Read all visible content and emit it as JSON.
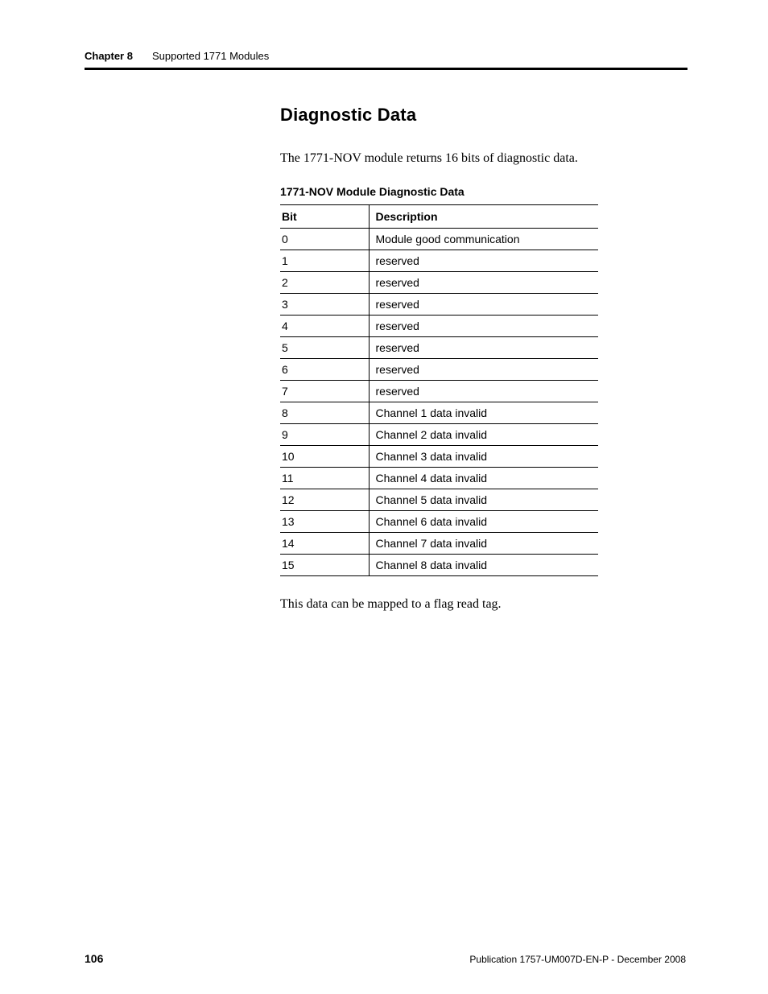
{
  "header": {
    "chapter_label": "Chapter 8",
    "chapter_title": "Supported 1771 Modules"
  },
  "section": {
    "heading": "Diagnostic Data",
    "intro": "The 1771-NOV module returns 16 bits of diagnostic data.",
    "table_title": "1771-NOV Module Diagnostic Data",
    "outro": "This data can be mapped to a flag read tag."
  },
  "table": {
    "col_bit": "Bit",
    "col_desc": "Description",
    "rows": [
      {
        "bit": "0",
        "desc": "Module good communication"
      },
      {
        "bit": "1",
        "desc": "reserved"
      },
      {
        "bit": "2",
        "desc": "reserved"
      },
      {
        "bit": "3",
        "desc": "reserved"
      },
      {
        "bit": "4",
        "desc": "reserved"
      },
      {
        "bit": "5",
        "desc": "reserved"
      },
      {
        "bit": "6",
        "desc": "reserved"
      },
      {
        "bit": "7",
        "desc": "reserved"
      },
      {
        "bit": "8",
        "desc": "Channel 1 data invalid"
      },
      {
        "bit": "9",
        "desc": "Channel 2 data invalid"
      },
      {
        "bit": "10",
        "desc": "Channel 3 data invalid"
      },
      {
        "bit": "11",
        "desc": "Channel 4 data invalid"
      },
      {
        "bit": "12",
        "desc": "Channel 5 data invalid"
      },
      {
        "bit": "13",
        "desc": "Channel 6 data invalid"
      },
      {
        "bit": "14",
        "desc": "Channel 7 data invalid"
      },
      {
        "bit": "15",
        "desc": "Channel 8 data invalid"
      }
    ]
  },
  "footer": {
    "page_number": "106",
    "publication": "Publication 1757-UM007D-EN-P - December 2008"
  }
}
